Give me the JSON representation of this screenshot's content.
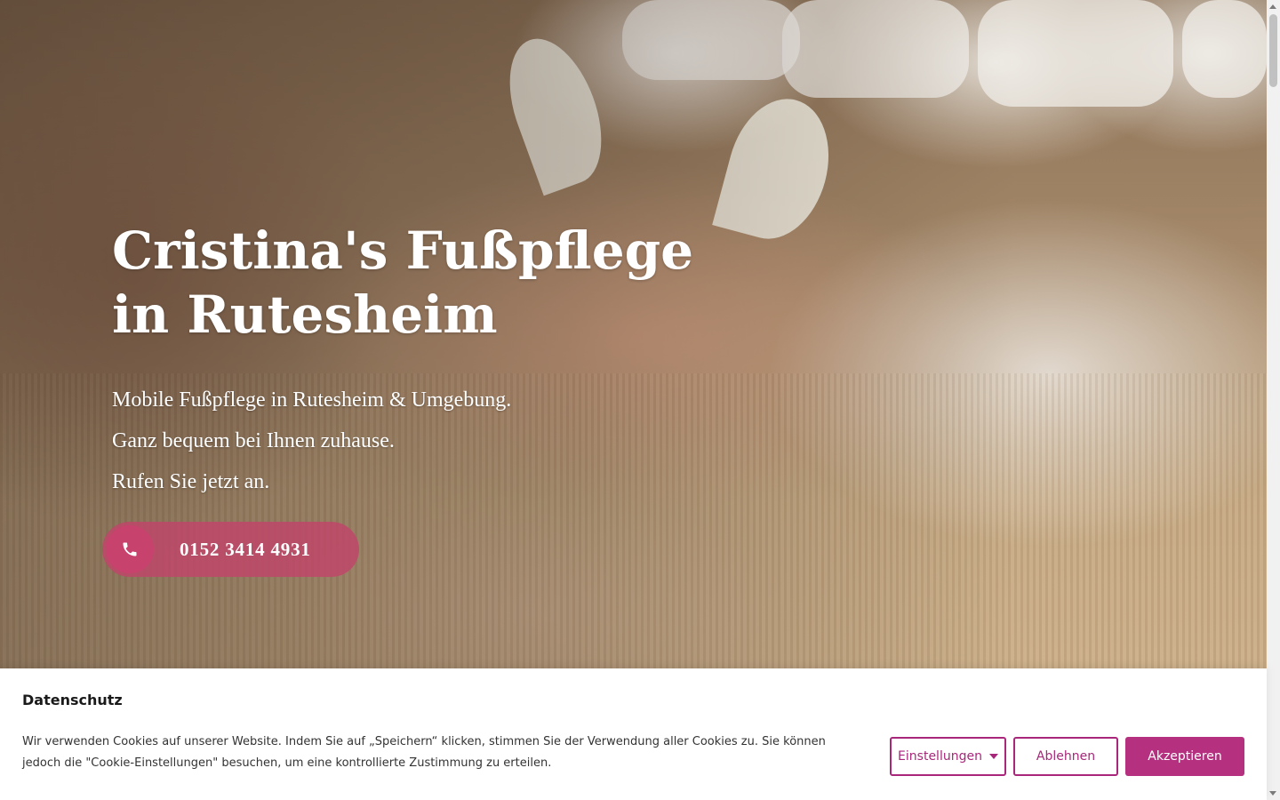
{
  "hero": {
    "title_line1": "Cristina's Fußpflege",
    "title_line2": "in Rutesheim",
    "lines": [
      "Mobile Fußpflege in Rutesheim & Umgebung.",
      "Ganz bequem bei Ihnen zuhause.",
      "Rufen Sie jetzt an."
    ],
    "phone": "0152 3414 4931",
    "phone_icon": "phone-icon"
  },
  "cookie": {
    "title": "Datenschutz",
    "text": "Wir verwenden Cookies auf unserer Website. Indem Sie auf „Speichern“ klicken, stimmen Sie der Verwendung aller Cookies zu. Sie können jedoch die \"Cookie-Einstellungen\" besuchen, um eine kontrollierte Zustimmung zu erteilen.",
    "settings_label": "Einstellungen",
    "decline_label": "Ablehnen",
    "accept_label": "Akzeptieren"
  },
  "colors": {
    "accent": "#b5307f",
    "call_button": "#be4669",
    "call_icon_bg": "#c8426e"
  }
}
